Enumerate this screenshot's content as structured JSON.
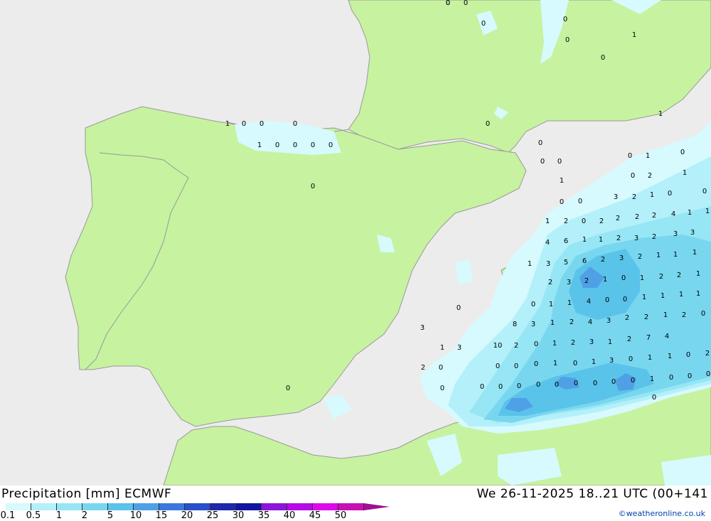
{
  "header": {
    "title_left": "Precipitation [mm] ECMWF",
    "title_right": "We 26-11-2025 18..21 UTC (00+141"
  },
  "legend": {
    "items": [
      {
        "label": "0.1",
        "color": "#d6fafe"
      },
      {
        "label": "0.5",
        "color": "#b4f0fa"
      },
      {
        "label": "1",
        "color": "#96e6f5"
      },
      {
        "label": "2",
        "color": "#78d7ef"
      },
      {
        "label": "5",
        "color": "#5ac3ea"
      },
      {
        "label": "10",
        "color": "#50a0e6"
      },
      {
        "label": "15",
        "color": "#3c78dc"
      },
      {
        "label": "20",
        "color": "#2850c8"
      },
      {
        "label": "25",
        "color": "#1e28aa"
      },
      {
        "label": "30",
        "color": "#1414a0"
      },
      {
        "label": "35",
        "color": "#8c14dc"
      },
      {
        "label": "40",
        "color": "#b40ae6"
      },
      {
        "label": "45",
        "color": "#dc0aeb"
      },
      {
        "label": "50",
        "color": "#c80fb4"
      }
    ],
    "arrow_color": "#a00f96"
  },
  "credit": "©weatheronline.co.uk",
  "colors": {
    "sea": "#ececec",
    "land": "#c7f2a0",
    "border": "#999999"
  },
  "values": [
    "0",
    "0",
    "0",
    "0",
    "1",
    "0",
    "0",
    "0",
    "1",
    "1",
    "0",
    "0",
    "0",
    "0",
    "0",
    "0",
    "0",
    "0",
    "0",
    "0",
    "1",
    "1",
    "0",
    "0",
    "0",
    "1",
    "0",
    "2",
    "1",
    "0",
    "0",
    "0",
    "3",
    "2",
    "1",
    "0",
    "1",
    "1",
    "2",
    "2",
    "2",
    "2",
    "0",
    "2",
    "1",
    "4",
    "3",
    "3",
    "2",
    "3",
    "2",
    "1",
    "1",
    "6",
    "4",
    "1",
    "1",
    "1",
    "2",
    "3",
    "2",
    "6",
    "5",
    "3",
    "1",
    "1",
    "2",
    "2",
    "1",
    "0",
    "1",
    "2",
    "3",
    "2",
    "1",
    "1",
    "1",
    "1",
    "0",
    "0",
    "4",
    "1",
    "1",
    "0",
    "0",
    "0",
    "2",
    "1",
    "2",
    "2",
    "3",
    "4",
    "2",
    "1",
    "3",
    "8",
    "3",
    "4",
    "7",
    "2",
    "1",
    "3",
    "2",
    "1",
    "0",
    "2",
    "10",
    "1",
    "3",
    "2",
    "0",
    "1",
    "1",
    "0",
    "3",
    "1",
    "0",
    "1",
    "0",
    "0",
    "0",
    "2",
    "0",
    "0",
    "0",
    "0",
    "1",
    "0",
    "0",
    "0",
    "0",
    "0",
    "0",
    "0",
    "0",
    "0",
    "0",
    "0",
    "0",
    "0"
  ]
}
